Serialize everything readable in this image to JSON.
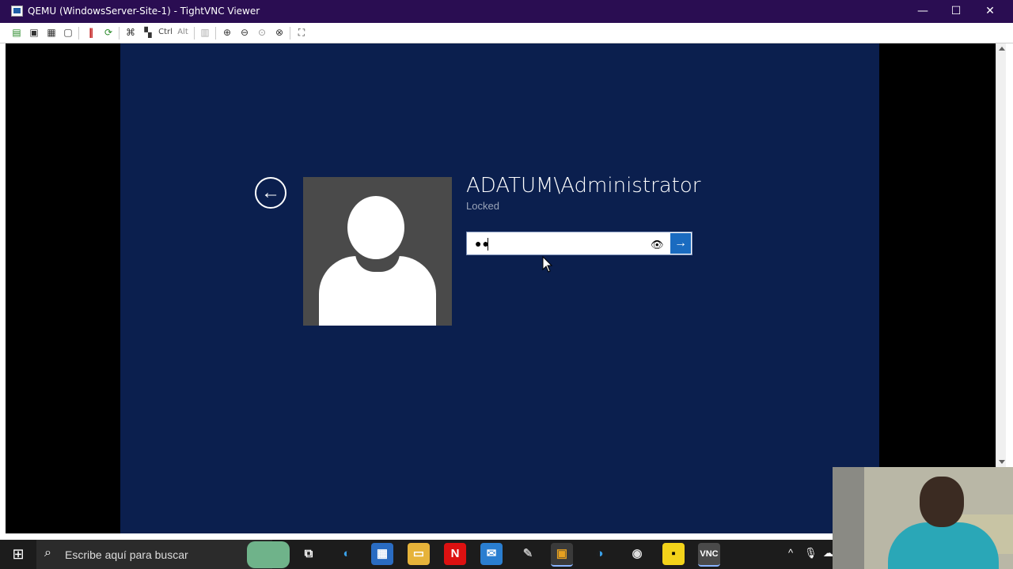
{
  "window": {
    "title": "QEMU (WindowsServer-Site-1) - TightVNC Viewer",
    "minimize": "—",
    "maximize": "☐",
    "close": "✕"
  },
  "toolbar": {
    "ctrl_label": "Ctrl",
    "alt_label": "Alt"
  },
  "lockscreen": {
    "back_glyph": "←",
    "username": "ADATUM\\Administrator",
    "status": "Locked",
    "password_masked": "●●",
    "reveal_glyph": "👁",
    "submit_glyph": "→"
  },
  "taskbar": {
    "search_placeholder": "Escribe aquí para buscar",
    "start_glyph": "⊞",
    "search_glyph": "⌕",
    "task_view_glyph": "⧉",
    "tray_chevron": "^",
    "tray_mic": "🎙"
  },
  "colors": {
    "titlebar": "#2a0d52",
    "lockscreen_bg": "#0b1f4e",
    "submit": "#1a6bc0"
  }
}
